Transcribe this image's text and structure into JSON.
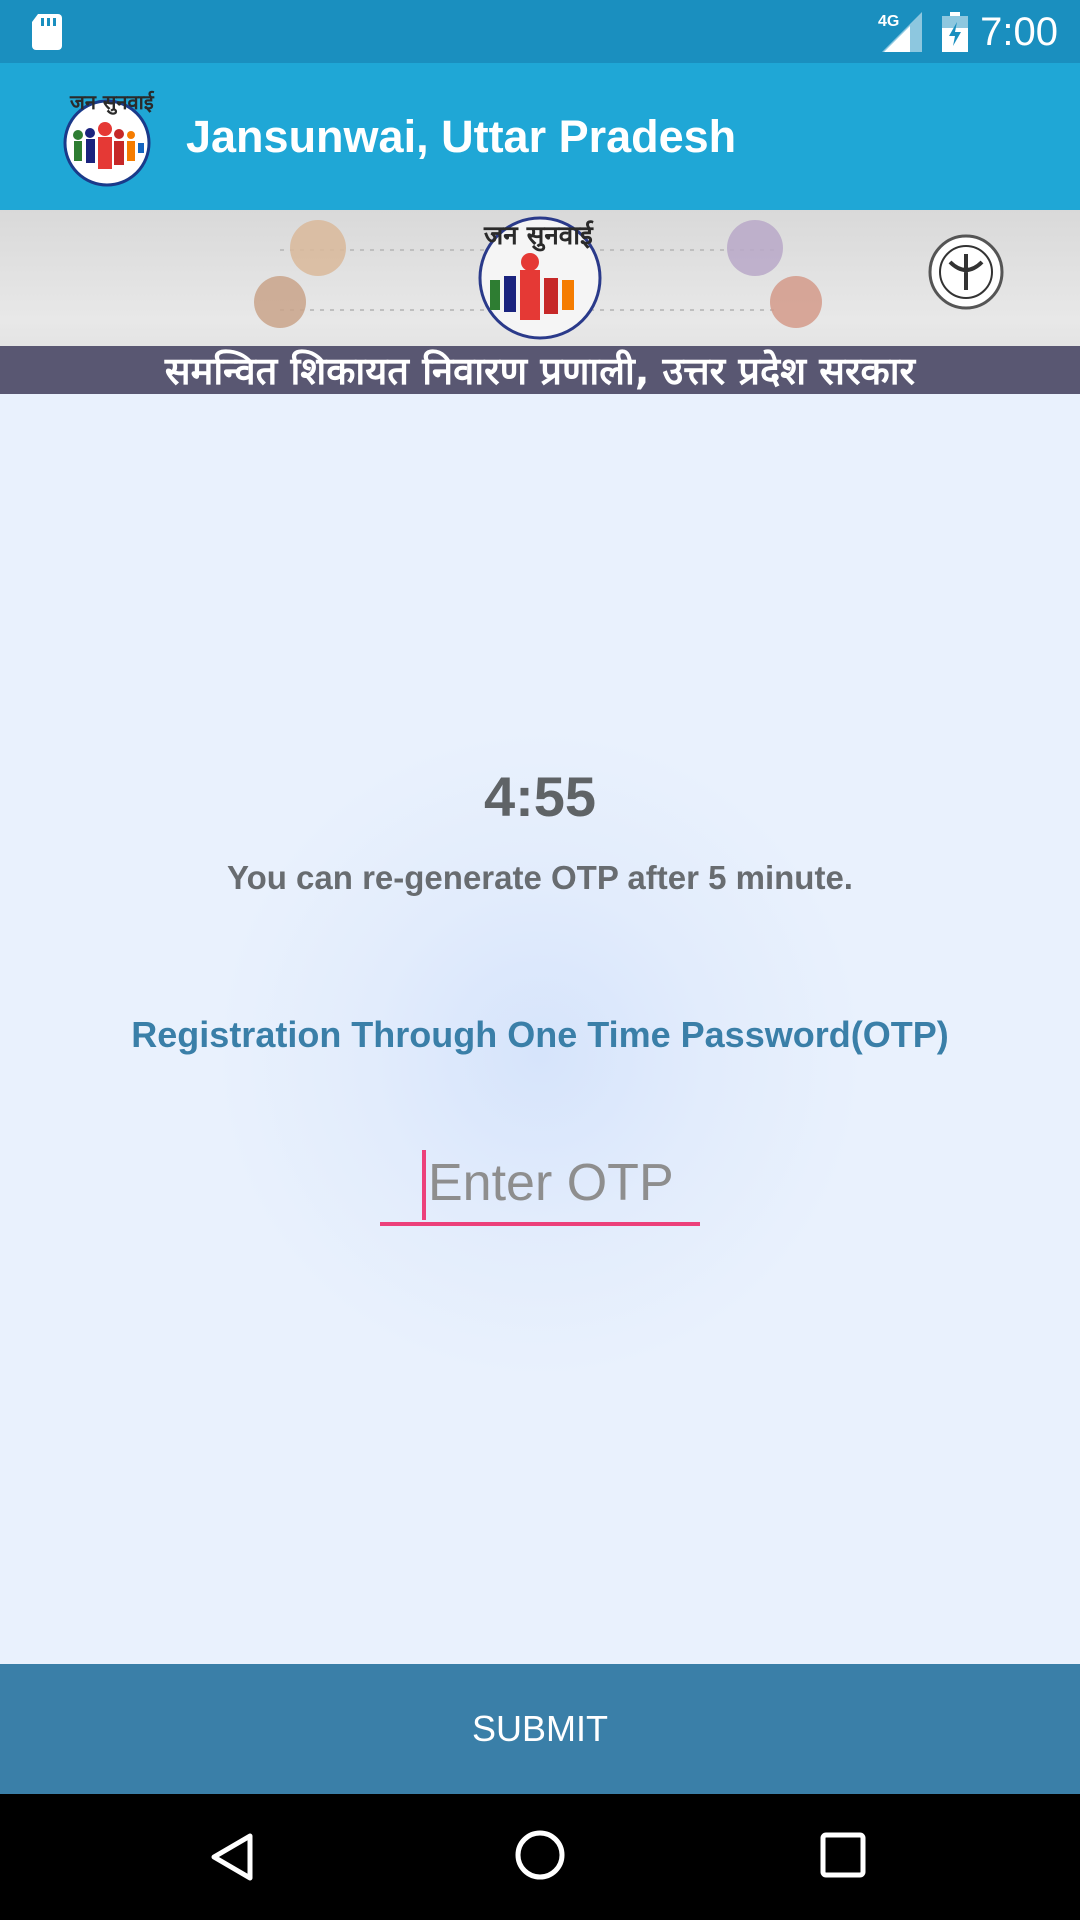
{
  "status_bar": {
    "time": "7:00",
    "network_label": "4G",
    "icons": [
      "sd-card-icon",
      "signal-4g-icon",
      "battery-charging-icon"
    ]
  },
  "app_bar": {
    "title": "Jansunwai, Uttar Pradesh",
    "logo_icon": "jansunwai-logo-icon"
  },
  "banner": {
    "tagline": "समन्वित शिकायत निवारण प्रणाली, उत्तर प्रदेश सरकार"
  },
  "main": {
    "timer": "4:55",
    "regen_text": "You can re-generate OTP after 5 minute.",
    "otp_heading": "Registration Through One Time Password(OTP)",
    "otp_input": {
      "value": "",
      "placeholder": "Enter OTP"
    }
  },
  "submit": {
    "label": "SUBMIT"
  },
  "nav_bar": {
    "icons": [
      "back-icon",
      "home-icon",
      "recents-icon"
    ]
  },
  "colors": {
    "status_bar": "#1a8fbf",
    "app_bar": "#1fa7d6",
    "accent": "#ec407a",
    "heading_blue": "#3a7fa8",
    "background": "#e9f1fd"
  }
}
